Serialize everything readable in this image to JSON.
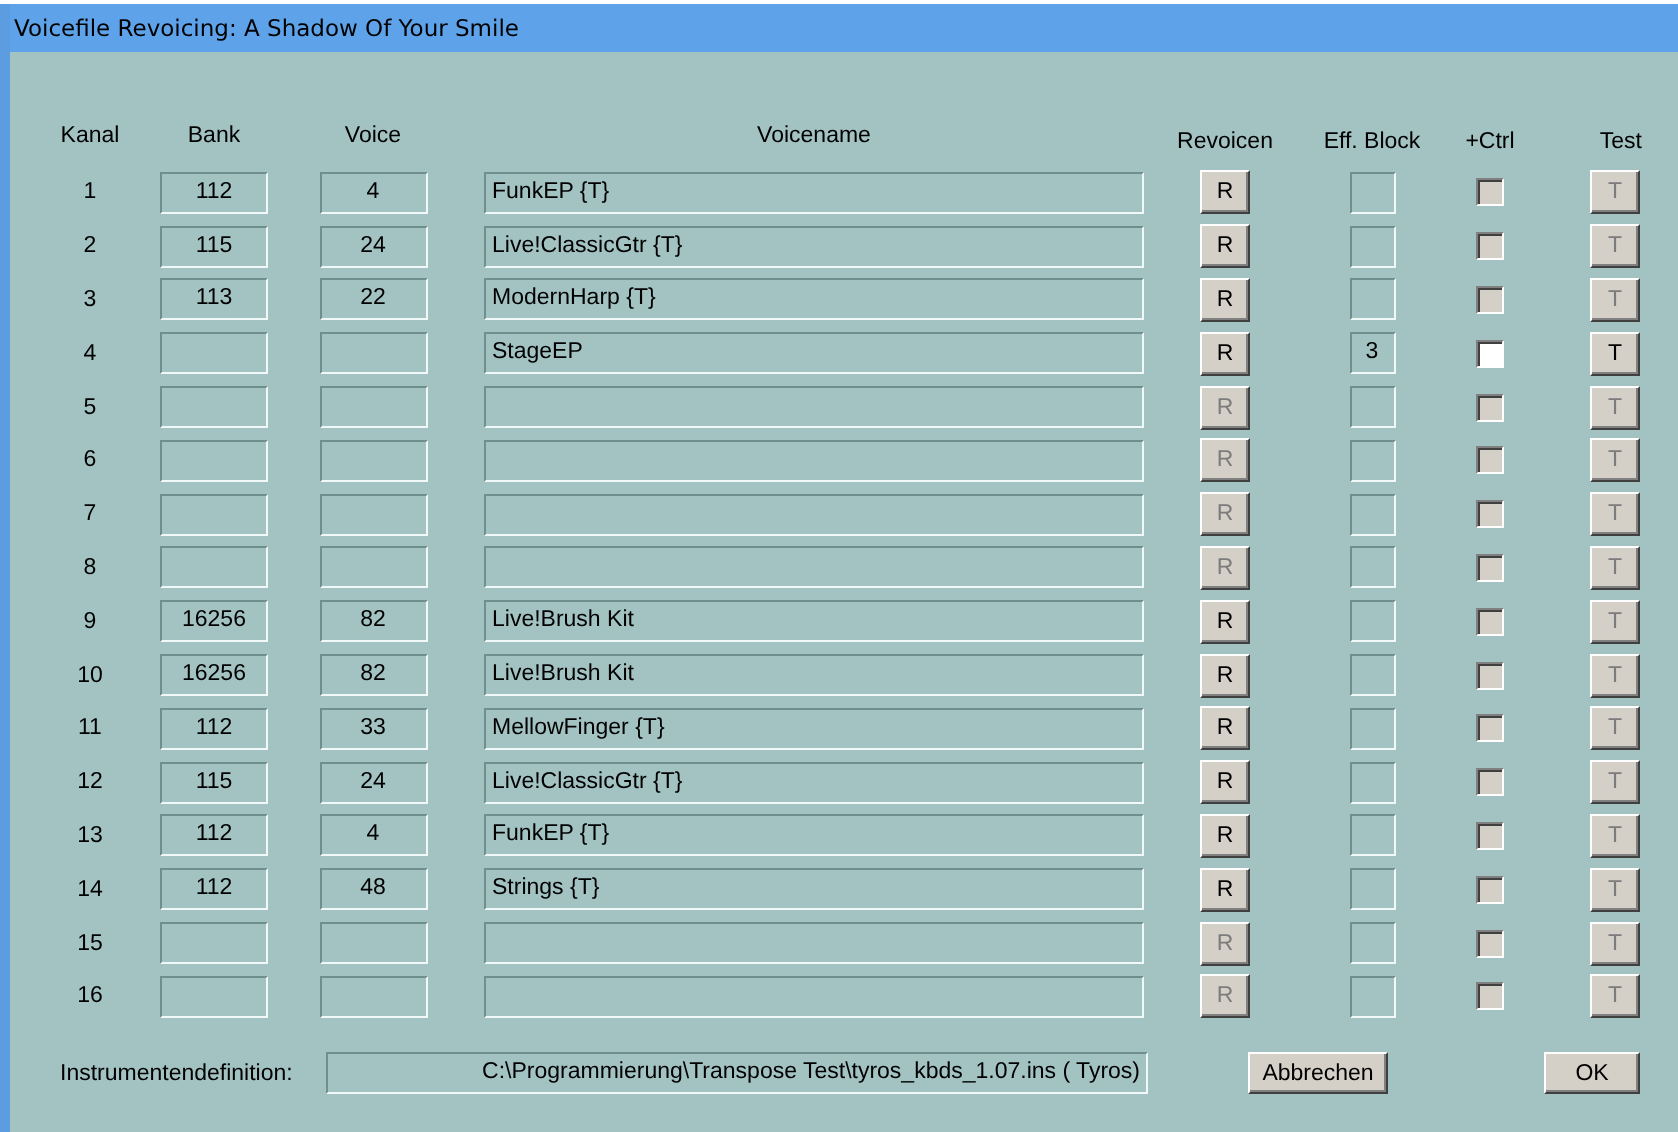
{
  "window": {
    "title": "Voicefile Revoicing:  A Shadow Of Your Smile"
  },
  "columns": [
    "Kanal",
    "Bank",
    "Voice",
    "Voicename",
    "Revoicen",
    "Eff. Block",
    "+Ctrl",
    "Test"
  ],
  "rows": [
    {
      "kanal": "1",
      "bank": "112",
      "voice": "4",
      "voicename": "FunkEP {T}",
      "revoice_disabled": false,
      "ctrl": {
        "checked": false,
        "disabled": true
      },
      "test_disabled": true
    },
    {
      "kanal": "2",
      "bank": "115",
      "voice": "24",
      "voicename": "Live!ClassicGtr {T}",
      "revoice_disabled": false,
      "ctrl": {
        "checked": false,
        "disabled": true
      },
      "test_disabled": true
    },
    {
      "kanal": "3",
      "bank": "113",
      "voice": "22",
      "voicename": "ModernHarp {T}",
      "revoice_disabled": false,
      "ctrl": {
        "checked": false,
        "disabled": true
      },
      "test_disabled": true
    },
    {
      "kanal": "4",
      "voicename": "StageEP",
      "revoice_disabled": false,
      "eff_block": "3",
      "ctrl": {
        "checked": false,
        "disabled": false
      },
      "test_disabled": false
    },
    {
      "kanal": "5",
      "revoice_disabled": true,
      "ctrl": {
        "checked": false,
        "disabled": true
      },
      "test_disabled": true
    },
    {
      "kanal": "6",
      "revoice_disabled": true,
      "ctrl": {
        "checked": false,
        "disabled": true
      },
      "test_disabled": true
    },
    {
      "kanal": "7",
      "revoice_disabled": true,
      "ctrl": {
        "checked": false,
        "disabled": true
      },
      "test_disabled": true
    },
    {
      "kanal": "8",
      "revoice_disabled": true,
      "ctrl": {
        "checked": false,
        "disabled": true
      },
      "test_disabled": true
    },
    {
      "kanal": "9",
      "bank": "16256",
      "voice": "82",
      "voicename": "Live!Brush Kit",
      "revoice_disabled": false,
      "ctrl": {
        "checked": false,
        "disabled": true
      },
      "test_disabled": true
    },
    {
      "kanal": "10",
      "bank": "16256",
      "voice": "82",
      "voicename": "Live!Brush Kit",
      "revoice_disabled": false,
      "ctrl": {
        "checked": false,
        "disabled": true
      },
      "test_disabled": true
    },
    {
      "kanal": "11",
      "bank": "112",
      "voice": "33",
      "voicename": "MellowFinger {T}",
      "revoice_disabled": false,
      "ctrl": {
        "checked": false,
        "disabled": true
      },
      "test_disabled": true
    },
    {
      "kanal": "12",
      "bank": "115",
      "voice": "24",
      "voicename": "Live!ClassicGtr {T}",
      "revoice_disabled": false,
      "ctrl": {
        "checked": false,
        "disabled": true
      },
      "test_disabled": true
    },
    {
      "kanal": "13",
      "bank": "112",
      "voice": "4",
      "voicename": "FunkEP {T}",
      "revoice_disabled": false,
      "ctrl": {
        "checked": false,
        "disabled": true
      },
      "test_disabled": true
    },
    {
      "kanal": "14",
      "bank": "112",
      "voice": "48",
      "voicename": "Strings {T}",
      "revoice_disabled": false,
      "ctrl": {
        "checked": false,
        "disabled": true
      },
      "test_disabled": true
    },
    {
      "kanal": "15",
      "revoice_disabled": true,
      "ctrl": {
        "checked": false,
        "disabled": true
      },
      "test_disabled": true
    },
    {
      "kanal": "16",
      "revoice_disabled": true,
      "ctrl": {
        "checked": false,
        "disabled": true
      },
      "test_disabled": true
    }
  ],
  "revoice_button": [
    "R",
    "R",
    "R",
    "R",
    "R",
    "R",
    "R",
    "R",
    "R",
    "R",
    "R",
    "R",
    "R",
    "R",
    "R",
    "R"
  ],
  "test_button": [
    "T",
    "T",
    "T",
    "T",
    "T",
    "T",
    "T",
    "T",
    "T",
    "T",
    "T",
    "T",
    "T",
    "T",
    "T",
    "T"
  ],
  "footer": {
    "label": "Instrumentendefinition:",
    "path": "C:\\Programmierung\\Transpose Test\\tyros_kbds_1.07.ins ( Tyros)",
    "cancel": "Abbrechen",
    "ok": "OK"
  }
}
